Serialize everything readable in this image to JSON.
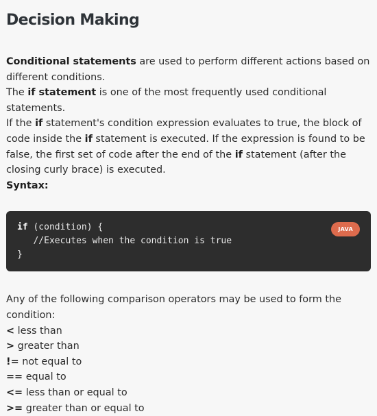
{
  "title": "Decision Making",
  "intro": {
    "p1_bold": "Conditional statements",
    "p1_rest": " are used to perform different actions based on different conditions.",
    "p2_pre": "The ",
    "p2_bold": "if statement",
    "p2_rest": " is one of the most frequently used conditional statements.",
    "p3_a": "If the ",
    "p3_b1": "if",
    "p3_b": " statement's condition expression evaluates to true, the block of code inside the ",
    "p3_b2": "if",
    "p3_c": " statement is executed. If the expression is found to be false, the first set of code after the end of the ",
    "p3_b3": "if",
    "p3_d": " statement (after the closing curly brace) is executed.",
    "syntax_label": "Syntax:"
  },
  "code": {
    "language_badge": "JAVA",
    "line1_kw": "if",
    "line1_rest": " (condition) {",
    "line2": "   //Executes when the condition is true",
    "line3": "}"
  },
  "operators_intro": "Any of the following comparison operators may be used to form the condition:",
  "operators": [
    {
      "symbol": "<",
      "desc": " less than"
    },
    {
      "symbol": ">",
      "desc": " greater than"
    },
    {
      "symbol": "!=",
      "desc": " not equal to"
    },
    {
      "symbol": "==",
      "desc": " equal to"
    },
    {
      "symbol": "<=",
      "desc": " less than or equal to"
    },
    {
      "symbol": ">=",
      "desc": " greater than or equal to"
    }
  ]
}
